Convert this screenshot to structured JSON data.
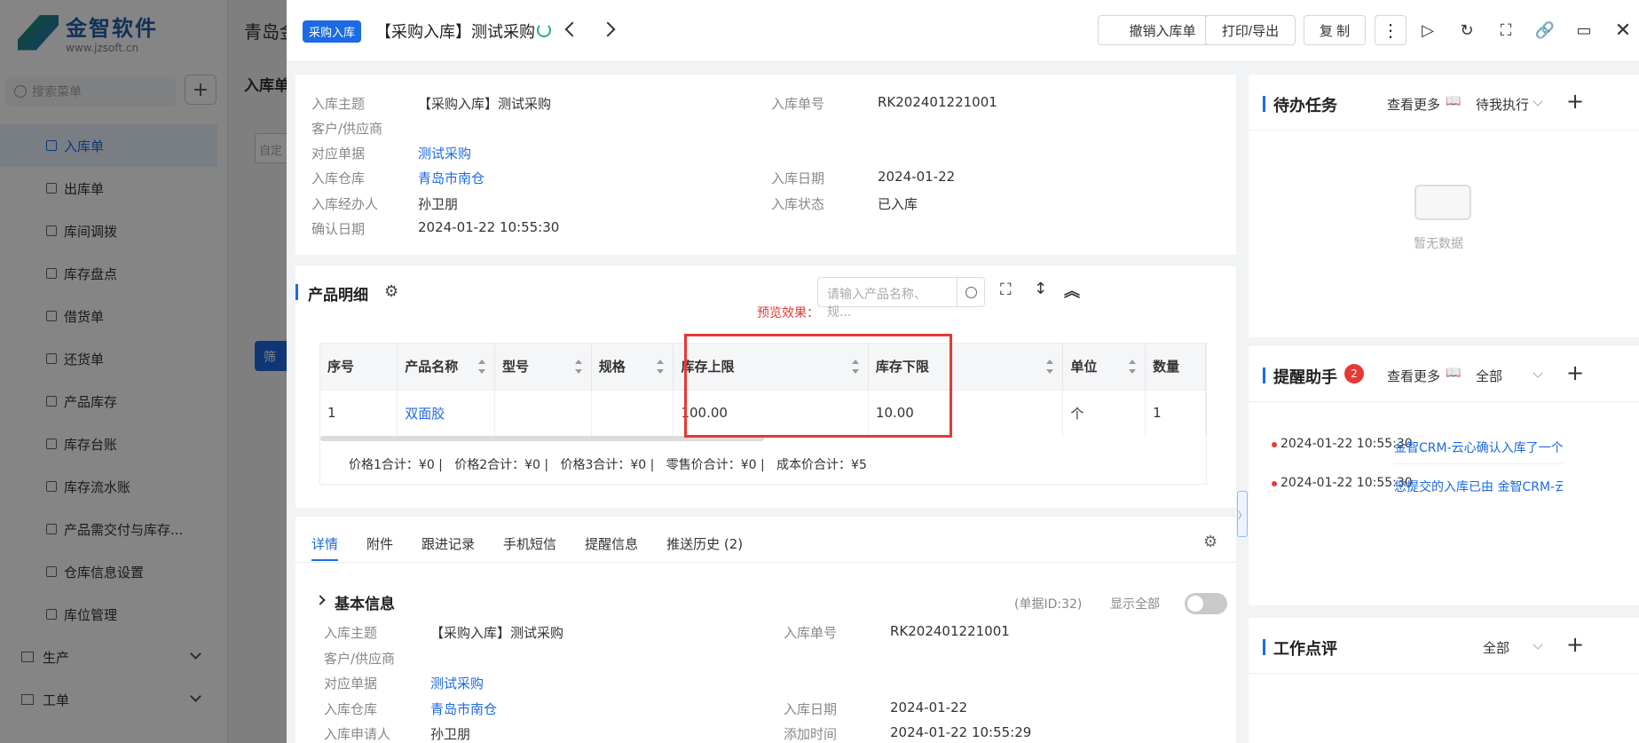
{
  "background": {
    "logo_title": "金智软件",
    "logo_url": "www.jzsoft.cn",
    "header_text": "青岛金",
    "tab_label": "入库单",
    "search_placeholder": "搜索菜单",
    "filter_btn": "筛",
    "input_hint": "自定",
    "menu": [
      {
        "label": "入库单",
        "icon": "inbound-icon"
      },
      {
        "label": "出库单",
        "icon": "outbound-icon"
      },
      {
        "label": "库间调拨",
        "icon": "transfer-icon"
      },
      {
        "label": "库存盘点",
        "icon": "inventory-icon"
      },
      {
        "label": "借货单",
        "icon": "borrow-icon"
      },
      {
        "label": "还货单",
        "icon": "return-icon"
      },
      {
        "label": "产品库存",
        "icon": "stock-icon"
      },
      {
        "label": "库存台账",
        "icon": "ledger-icon"
      },
      {
        "label": "库存流水账",
        "icon": "journal-icon"
      },
      {
        "label": "产品需交付与库存...",
        "icon": "delivery-icon"
      },
      {
        "label": "仓库信息设置",
        "icon": "settings-icon"
      },
      {
        "label": "库位管理",
        "icon": "location-icon"
      }
    ],
    "groups": [
      {
        "label": "生产"
      },
      {
        "label": "工单"
      }
    ]
  },
  "header": {
    "tag": "采购入库",
    "title": "【采购入库】测试采购",
    "btn_cancel": "撤销入库单",
    "btn_print": "打印/导出",
    "btn_copy": "复 制"
  },
  "summary": {
    "subject_label": "入库主题",
    "subject": "【采购入库】测试采购",
    "number_label": "入库单号",
    "number": "RK202401221001",
    "customer_label": "客户/供应商",
    "ref_label": "对应单据",
    "ref": "测试采购",
    "warehouse_label": "入库仓库",
    "warehouse": "青岛市南仓",
    "date_label": "入库日期",
    "date": "2024-01-22",
    "handler_label": "入库经办人",
    "handler": "孙卫朋",
    "status_label": "入库状态",
    "status": "已入库",
    "confirm_label": "确认日期",
    "confirm": "2024-01-22 10:55:30"
  },
  "products": {
    "title": "产品明细",
    "search_placeholder": "请输入产品名称、规...",
    "preview_note": "预览效果：",
    "columns": [
      "序号",
      "产品名称",
      "型号",
      "规格",
      "库存上限",
      "库存下限",
      "单位",
      "数量"
    ],
    "rows": [
      {
        "no": "1",
        "name": "双面胶",
        "model": "",
        "spec": "",
        "upper": "100.00",
        "lower": "10.00",
        "unit": "个",
        "qty": "1"
      }
    ],
    "totals": "价格1合计：¥0 |   价格2合计：¥0 |   价格3合计：¥0 |   零售价合计：¥0 |   成本价合计：¥5"
  },
  "detail": {
    "tabs": [
      "详情",
      "附件",
      "跟进记录",
      "手机短信",
      "提醒信息",
      "推送历史 (2)"
    ],
    "section": "基本信息",
    "doc_id": "(单据ID:32)",
    "show_all": "显示全部",
    "subject_label": "入库主题",
    "subject": "【采购入库】测试采购",
    "number_label": "入库单号",
    "number": "RK202401221001",
    "customer_label": "客户/供应商",
    "ref_label": "对应单据",
    "ref": "测试采购",
    "warehouse_label": "入库仓库",
    "warehouse": "青岛市南仓",
    "date_label": "入库日期",
    "date": "2024-01-22",
    "applicant_label": "入库申请人",
    "applicant": "孙卫朋",
    "added_label": "添加时间",
    "added": "2024-01-22 10:55:29"
  },
  "right": {
    "todo_title": "待办任务",
    "todo_more": "查看更多",
    "todo_filter": "待我执行",
    "empty": "暂无数据",
    "remind_title": "提醒助手",
    "remind_badge": "2",
    "remind_more": "查看更多",
    "remind_filter": "全部",
    "reminders": [
      {
        "time": "2024-01-22 10:55:30",
        "text": "金智CRM-云心确认入库了一个 ..."
      },
      {
        "time": "2024-01-22 10:55:30",
        "text": "您提交的入库已由 金智CRM-云..."
      }
    ],
    "review_title": "工作点评",
    "review_filter": "全部"
  }
}
